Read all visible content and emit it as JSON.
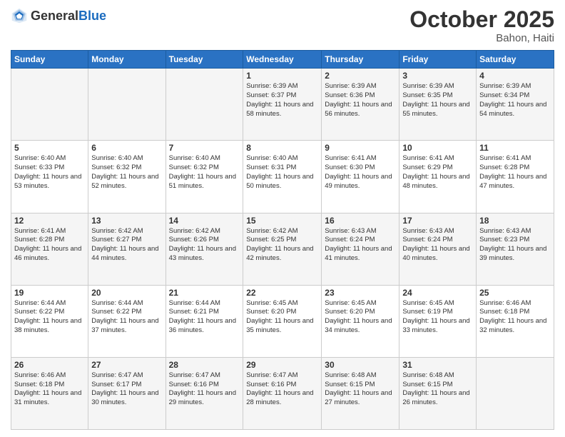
{
  "header": {
    "logo_general": "General",
    "logo_blue": "Blue",
    "month": "October 2025",
    "location": "Bahon, Haiti"
  },
  "weekdays": [
    "Sunday",
    "Monday",
    "Tuesday",
    "Wednesday",
    "Thursday",
    "Friday",
    "Saturday"
  ],
  "weeks": [
    [
      {
        "day": "",
        "info": ""
      },
      {
        "day": "",
        "info": ""
      },
      {
        "day": "",
        "info": ""
      },
      {
        "day": "1",
        "info": "Sunrise: 6:39 AM\nSunset: 6:37 PM\nDaylight: 11 hours and 58 minutes."
      },
      {
        "day": "2",
        "info": "Sunrise: 6:39 AM\nSunset: 6:36 PM\nDaylight: 11 hours and 56 minutes."
      },
      {
        "day": "3",
        "info": "Sunrise: 6:39 AM\nSunset: 6:35 PM\nDaylight: 11 hours and 55 minutes."
      },
      {
        "day": "4",
        "info": "Sunrise: 6:39 AM\nSunset: 6:34 PM\nDaylight: 11 hours and 54 minutes."
      }
    ],
    [
      {
        "day": "5",
        "info": "Sunrise: 6:40 AM\nSunset: 6:33 PM\nDaylight: 11 hours and 53 minutes."
      },
      {
        "day": "6",
        "info": "Sunrise: 6:40 AM\nSunset: 6:32 PM\nDaylight: 11 hours and 52 minutes."
      },
      {
        "day": "7",
        "info": "Sunrise: 6:40 AM\nSunset: 6:32 PM\nDaylight: 11 hours and 51 minutes."
      },
      {
        "day": "8",
        "info": "Sunrise: 6:40 AM\nSunset: 6:31 PM\nDaylight: 11 hours and 50 minutes."
      },
      {
        "day": "9",
        "info": "Sunrise: 6:41 AM\nSunset: 6:30 PM\nDaylight: 11 hours and 49 minutes."
      },
      {
        "day": "10",
        "info": "Sunrise: 6:41 AM\nSunset: 6:29 PM\nDaylight: 11 hours and 48 minutes."
      },
      {
        "day": "11",
        "info": "Sunrise: 6:41 AM\nSunset: 6:28 PM\nDaylight: 11 hours and 47 minutes."
      }
    ],
    [
      {
        "day": "12",
        "info": "Sunrise: 6:41 AM\nSunset: 6:28 PM\nDaylight: 11 hours and 46 minutes."
      },
      {
        "day": "13",
        "info": "Sunrise: 6:42 AM\nSunset: 6:27 PM\nDaylight: 11 hours and 44 minutes."
      },
      {
        "day": "14",
        "info": "Sunrise: 6:42 AM\nSunset: 6:26 PM\nDaylight: 11 hours and 43 minutes."
      },
      {
        "day": "15",
        "info": "Sunrise: 6:42 AM\nSunset: 6:25 PM\nDaylight: 11 hours and 42 minutes."
      },
      {
        "day": "16",
        "info": "Sunrise: 6:43 AM\nSunset: 6:24 PM\nDaylight: 11 hours and 41 minutes."
      },
      {
        "day": "17",
        "info": "Sunrise: 6:43 AM\nSunset: 6:24 PM\nDaylight: 11 hours and 40 minutes."
      },
      {
        "day": "18",
        "info": "Sunrise: 6:43 AM\nSunset: 6:23 PM\nDaylight: 11 hours and 39 minutes."
      }
    ],
    [
      {
        "day": "19",
        "info": "Sunrise: 6:44 AM\nSunset: 6:22 PM\nDaylight: 11 hours and 38 minutes."
      },
      {
        "day": "20",
        "info": "Sunrise: 6:44 AM\nSunset: 6:22 PM\nDaylight: 11 hours and 37 minutes."
      },
      {
        "day": "21",
        "info": "Sunrise: 6:44 AM\nSunset: 6:21 PM\nDaylight: 11 hours and 36 minutes."
      },
      {
        "day": "22",
        "info": "Sunrise: 6:45 AM\nSunset: 6:20 PM\nDaylight: 11 hours and 35 minutes."
      },
      {
        "day": "23",
        "info": "Sunrise: 6:45 AM\nSunset: 6:20 PM\nDaylight: 11 hours and 34 minutes."
      },
      {
        "day": "24",
        "info": "Sunrise: 6:45 AM\nSunset: 6:19 PM\nDaylight: 11 hours and 33 minutes."
      },
      {
        "day": "25",
        "info": "Sunrise: 6:46 AM\nSunset: 6:18 PM\nDaylight: 11 hours and 32 minutes."
      }
    ],
    [
      {
        "day": "26",
        "info": "Sunrise: 6:46 AM\nSunset: 6:18 PM\nDaylight: 11 hours and 31 minutes."
      },
      {
        "day": "27",
        "info": "Sunrise: 6:47 AM\nSunset: 6:17 PM\nDaylight: 11 hours and 30 minutes."
      },
      {
        "day": "28",
        "info": "Sunrise: 6:47 AM\nSunset: 6:16 PM\nDaylight: 11 hours and 29 minutes."
      },
      {
        "day": "29",
        "info": "Sunrise: 6:47 AM\nSunset: 6:16 PM\nDaylight: 11 hours and 28 minutes."
      },
      {
        "day": "30",
        "info": "Sunrise: 6:48 AM\nSunset: 6:15 PM\nDaylight: 11 hours and 27 minutes."
      },
      {
        "day": "31",
        "info": "Sunrise: 6:48 AM\nSunset: 6:15 PM\nDaylight: 11 hours and 26 minutes."
      },
      {
        "day": "",
        "info": ""
      }
    ]
  ]
}
